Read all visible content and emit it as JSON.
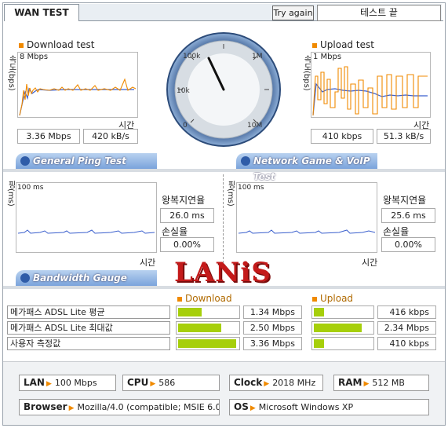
{
  "tab_title": "WAN TEST",
  "try_again": "Try again",
  "status": "테스트 끝",
  "download": {
    "title": "Download test",
    "scale": "8 Mbps",
    "ylabel": "속도(bps)",
    "xlabel": "시간",
    "mbps": "3.36 Mbps",
    "kBs": "420 kB/s"
  },
  "upload": {
    "title": "Upload test",
    "scale": "1 Mbps",
    "ylabel": "속도(bps)",
    "xlabel": "시간",
    "kbps": "410 kbps",
    "kBs": "51.3 kB/s"
  },
  "gauge": {
    "labels": [
      "0",
      "10k",
      "100k",
      "1M",
      "10M"
    ],
    "needle_value": "1M"
  },
  "sections": {
    "ping": "General Ping Test",
    "game": "Network Game & VoIP Test",
    "bandwidth": "Bandwidth Gauge"
  },
  "ping": {
    "ylabel": "핑(ms)",
    "scale": "100 ms",
    "xlabel": "시간",
    "rtt_label": "왕복지연율",
    "rtt": "26.0 ms",
    "loss_label": "손실율",
    "loss": "0.00%"
  },
  "game": {
    "ylabel": "핑(ms)",
    "scale": "100 ms",
    "xlabel": "시간",
    "rtt_label": "왕복지연율",
    "rtt": "25.6 ms",
    "loss_label": "손실율",
    "loss": "0.00%"
  },
  "logo": "LANiS",
  "bandwidth": {
    "download_header": "Download",
    "upload_header": "Upload",
    "rows": [
      {
        "label": "메가패스 ADSL Lite 평균",
        "down": "1.34 Mbps",
        "down_fill": 0.4,
        "up": "416 kbps",
        "up_fill": 0.17
      },
      {
        "label": "메가패스 ADSL Lite 최대값",
        "down": "2.50 Mbps",
        "down_fill": 0.72,
        "up": "2.34 Mbps",
        "up_fill": 0.82
      },
      {
        "label": "사용자 측정값",
        "down": "3.36 Mbps",
        "down_fill": 0.98,
        "up": "410 kbps",
        "up_fill": 0.17
      }
    ]
  },
  "sysinfo": {
    "lan_label": "LAN",
    "lan": "100 Mbps",
    "cpu_label": "CPU",
    "cpu": "586",
    "clock_label": "Clock",
    "clock": "2018 MHz",
    "ram_label": "RAM",
    "ram": "512 MB",
    "browser_label": "Browser",
    "browser": "Mozilla/4.0 (compatible; MSIE 6.0",
    "os_label": "OS",
    "os": "Microsoft Windows XP"
  },
  "colors": {
    "accent": "#f08a00",
    "bar": "#a6cf0a",
    "line": "#3a5fcd",
    "logo": "#c41a1a"
  }
}
